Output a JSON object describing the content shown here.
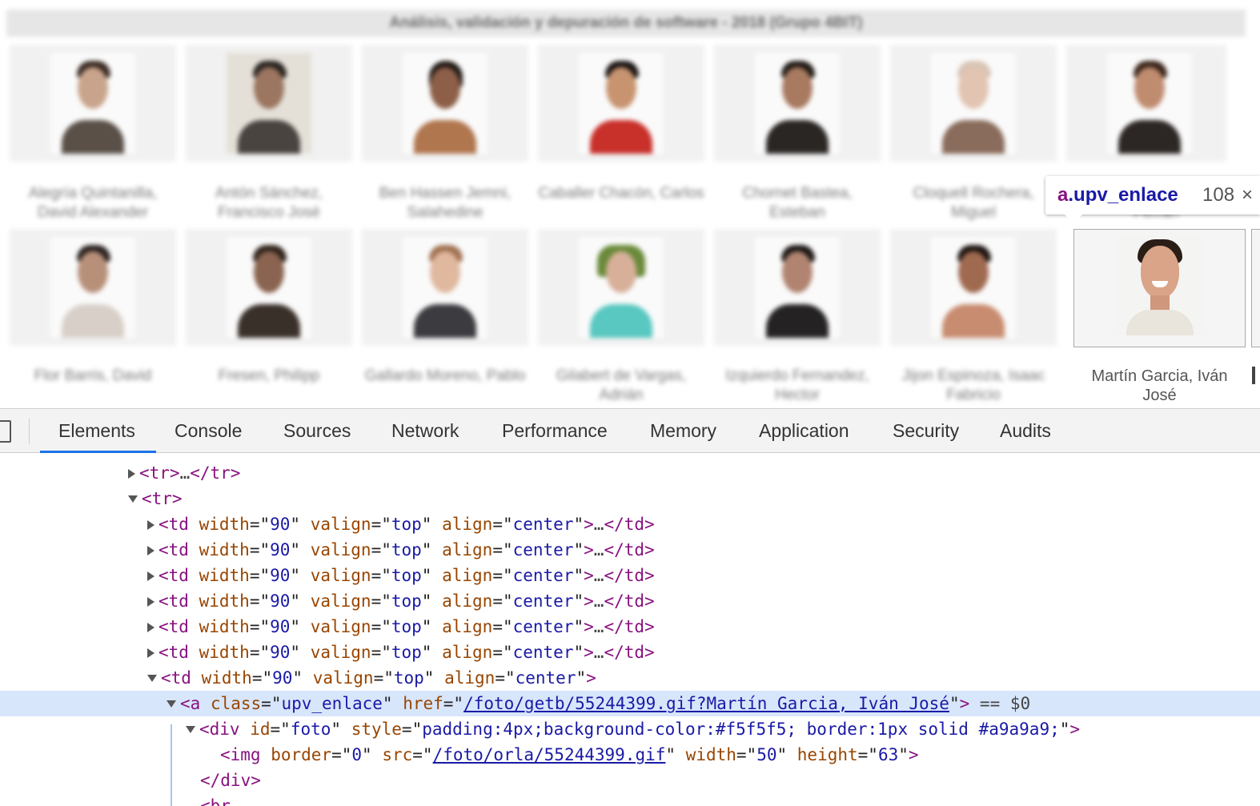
{
  "page": {
    "title": "Análisis, validación y depuración de software - 2018 (Grupo 4BIT)",
    "row1_names": [
      "Alegría Quintanilla, David Alexander",
      "Antón Sánchez, Francisco José",
      "Ben Hassen Jemni, Salahedine",
      "Caballer Chacón, Carlos",
      "Chornet Bastea, Esteban",
      "Cloquell Rochera, Miguel",
      "Ferran"
    ],
    "row2_names": [
      "Flor Barris, David",
      "Fresen, Philipp",
      "Gallardo Moreno, Pablo",
      "Gilabert de Vargas, Adrián",
      "Izquierdo Fernandez, Hector",
      "Jijon Espinoza, Isaac Fabricio"
    ],
    "highlighted_name": "Martín Garcia, Iván José"
  },
  "tooltip": {
    "tag": "a",
    "class": ".upv_enlace",
    "size": "108",
    "close": "×"
  },
  "devtools": {
    "tabs": [
      "Elements",
      "Console",
      "Sources",
      "Network",
      "Performance",
      "Memory",
      "Application",
      "Security",
      "Audits"
    ],
    "active_tab": "Elements",
    "tr_open": "<tr>",
    "tr_collapsed_dots": "…",
    "tr_close": "</tr>",
    "td_tag": "<td",
    "td_attrs": [
      {
        "name": "width",
        "value": "90"
      },
      {
        "name": "valign",
        "value": "top"
      },
      {
        "name": "align",
        "value": "center"
      }
    ],
    "td_close": "</td>",
    "a_tag": "<a",
    "a_class_name": "class",
    "a_class_value": "upv_enlace",
    "a_href_name": "href",
    "a_href_value": "/foto/getb/55244399.gif?Martín Garcia, Iván José",
    "selected_marker": "== $0",
    "div_tag": "<div",
    "div_id_name": "id",
    "div_id_value": "foto",
    "div_style_name": "style",
    "div_style_value": "padding:4px;background-color:#f5f5f5; border:1px solid #a9a9a9;",
    "img_tag": "<img",
    "img_border_name": "border",
    "img_border_value": "0",
    "img_src_name": "src",
    "img_src_value": "/foto/orla/55244399.gif",
    "img_width_name": "width",
    "img_width_value": "50",
    "img_height_name": "height",
    "img_height_value": "63",
    "div_close": "</div>",
    "br_tag": "<br"
  },
  "colors": {
    "accent": "#1a73e8",
    "tag": "#881280",
    "attr_name": "#994500",
    "attr_value": "#1a1aa6",
    "selection": "#d8e6fb"
  }
}
